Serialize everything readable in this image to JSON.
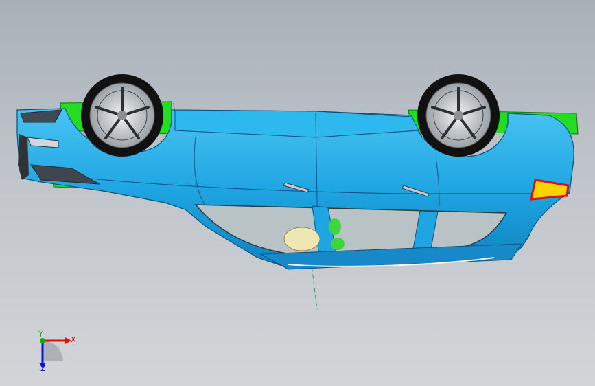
{
  "viewport": {
    "background_top": "#a9b0b8",
    "background_bottom": "#d2d5d8"
  },
  "model": {
    "body_color": "#1fa6e2",
    "body_dark": "#0d6fa8",
    "underbody_color": "#22dd22",
    "glass_color": "#b9c3c6",
    "tire_color": "#111111",
    "rim_color": "#cfd3d6",
    "taillight_colors": [
      "#ffd200",
      "#e01010"
    ]
  },
  "triad": {
    "x_label": "X",
    "y_label": "Y",
    "z_label": "Z",
    "x_color": "#dd1111",
    "y_color": "#11aa11",
    "z_color": "#1111cc"
  }
}
